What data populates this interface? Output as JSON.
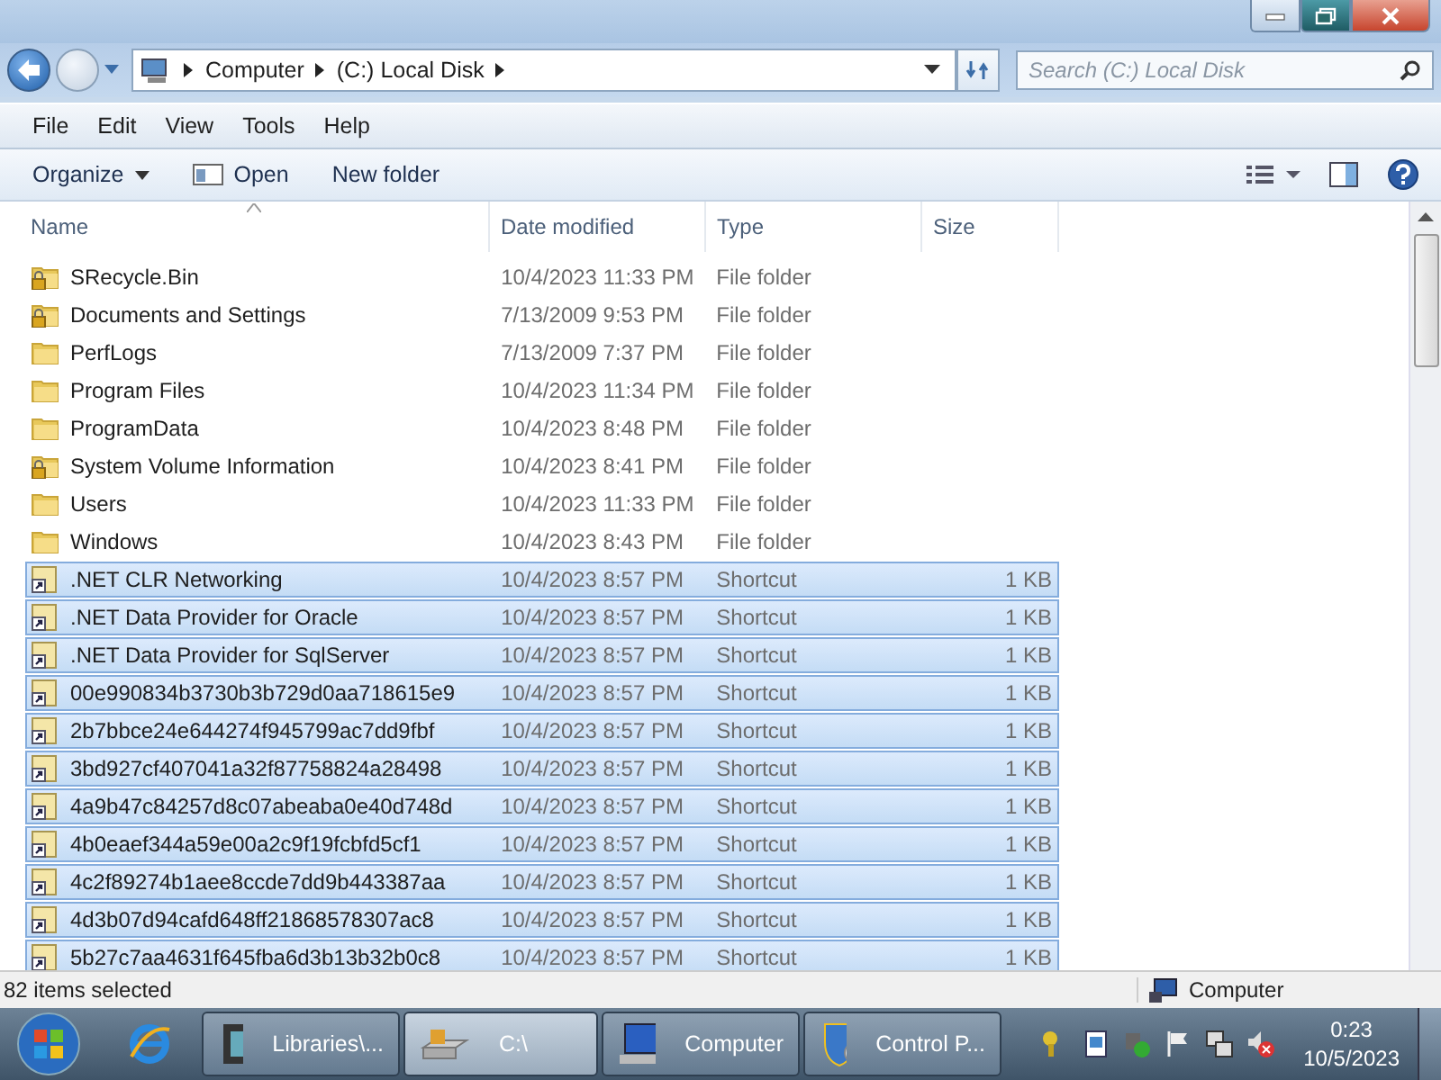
{
  "address": {
    "crumbs": [
      "Computer",
      "(C:) Local Disk"
    ]
  },
  "search": {
    "placeholder": "Search (C:) Local Disk"
  },
  "menu": [
    "File",
    "Edit",
    "View",
    "Tools",
    "Help"
  ],
  "commands": [
    {
      "label": "Organize",
      "kind": "dropdown"
    },
    {
      "label": "Open",
      "kind": "open"
    },
    {
      "label": "New folder",
      "kind": "plain"
    }
  ],
  "columns": [
    "Name",
    "Date modified",
    "Type",
    "Size"
  ],
  "rows": [
    {
      "name": "SRecycle.Bin",
      "date": "10/4/2023 11:33 PM",
      "type": "File folder",
      "size": "",
      "kind": "locked-folder",
      "selected": false
    },
    {
      "name": "Documents and Settings",
      "date": "7/13/2009 9:53 PM",
      "type": "File folder",
      "size": "",
      "kind": "locked-folder",
      "selected": false
    },
    {
      "name": "PerfLogs",
      "date": "7/13/2009 7:37 PM",
      "type": "File folder",
      "size": "",
      "kind": "folder",
      "selected": false
    },
    {
      "name": "Program Files",
      "date": "10/4/2023 11:34 PM",
      "type": "File folder",
      "size": "",
      "kind": "folder",
      "selected": false
    },
    {
      "name": "ProgramData",
      "date": "10/4/2023 8:48 PM",
      "type": "File folder",
      "size": "",
      "kind": "folder",
      "selected": false
    },
    {
      "name": "System Volume Information",
      "date": "10/4/2023 8:41 PM",
      "type": "File folder",
      "size": "",
      "kind": "locked-folder",
      "selected": false
    },
    {
      "name": "Users",
      "date": "10/4/2023 11:33 PM",
      "type": "File folder",
      "size": "",
      "kind": "folder",
      "selected": false
    },
    {
      "name": "Windows",
      "date": "10/4/2023 8:43 PM",
      "type": "File folder",
      "size": "",
      "kind": "folder",
      "selected": false
    },
    {
      "name": ".NET CLR Networking",
      "date": "10/4/2023 8:57 PM",
      "type": "Shortcut",
      "size": "1 KB",
      "kind": "shortcut",
      "selected": true
    },
    {
      "name": ".NET Data Provider for Oracle",
      "date": "10/4/2023 8:57 PM",
      "type": "Shortcut",
      "size": "1 KB",
      "kind": "shortcut",
      "selected": true
    },
    {
      "name": ".NET Data Provider for SqlServer",
      "date": "10/4/2023 8:57 PM",
      "type": "Shortcut",
      "size": "1 KB",
      "kind": "shortcut",
      "selected": true
    },
    {
      "name": "00e990834b3730b3b729d0aa718615e9",
      "date": "10/4/2023 8:57 PM",
      "type": "Shortcut",
      "size": "1 KB",
      "kind": "shortcut",
      "selected": true
    },
    {
      "name": "2b7bbce24e644274f945799ac7dd9fbf",
      "date": "10/4/2023 8:57 PM",
      "type": "Shortcut",
      "size": "1 KB",
      "kind": "shortcut",
      "selected": true
    },
    {
      "name": "3bd927cf407041a32f87758824a28498",
      "date": "10/4/2023 8:57 PM",
      "type": "Shortcut",
      "size": "1 KB",
      "kind": "shortcut",
      "selected": true
    },
    {
      "name": "4a9b47c84257d8c07abeaba0e40d748d",
      "date": "10/4/2023 8:57 PM",
      "type": "Shortcut",
      "size": "1 KB",
      "kind": "shortcut",
      "selected": true
    },
    {
      "name": "4b0eaef344a59e00a2c9f19fcbfd5cf1",
      "date": "10/4/2023 8:57 PM",
      "type": "Shortcut",
      "size": "1 KB",
      "kind": "shortcut",
      "selected": true
    },
    {
      "name": "4c2f89274b1aee8ccde7dd9b443387aa",
      "date": "10/4/2023 8:57 PM",
      "type": "Shortcut",
      "size": "1 KB",
      "kind": "shortcut",
      "selected": true
    },
    {
      "name": "4d3b07d94cafd648ff21868578307ac8",
      "date": "10/4/2023 8:57 PM",
      "type": "Shortcut",
      "size": "1 KB",
      "kind": "shortcut",
      "selected": true
    },
    {
      "name": "5b27c7aa4631f645fba6d3b13b32b0c8",
      "date": "10/4/2023 8:57 PM",
      "type": "Shortcut",
      "size": "1 KB",
      "kind": "shortcut",
      "selected": true
    }
  ],
  "status_bar": {
    "selection": "82 items selected",
    "location": "Computer"
  },
  "taskbar": {
    "tasks": [
      {
        "label": "Libraries\\...",
        "kind": "media",
        "selected": false
      },
      {
        "label": "C:\\",
        "kind": "drive",
        "selected": true
      },
      {
        "label": "Computer",
        "kind": "computer",
        "selected": false
      },
      {
        "label": "Control P...",
        "kind": "control",
        "selected": false
      }
    ],
    "time": "0:23",
    "date": "10/5/2023"
  }
}
